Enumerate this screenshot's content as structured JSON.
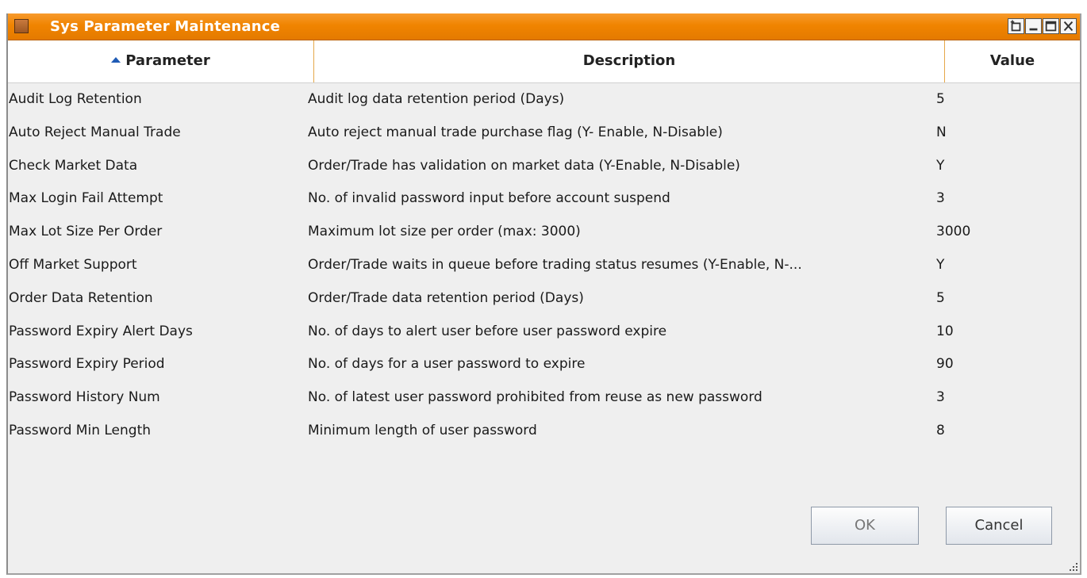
{
  "window": {
    "title": "Sys Parameter Maintenance",
    "controls": [
      "pin-icon",
      "minimize-icon",
      "maximize-icon",
      "close-icon"
    ]
  },
  "table": {
    "columns": [
      "Parameter",
      "Description",
      "Value"
    ],
    "sort": {
      "column": "Parameter",
      "direction": "ascending"
    },
    "rows": [
      {
        "parameter": "Audit Log Retention",
        "description": "Audit log data retention period (Days)",
        "value": "5"
      },
      {
        "parameter": "Auto Reject Manual Trade",
        "description": "Auto reject manual trade purchase flag (Y- Enable, N-Disable)",
        "value": "N"
      },
      {
        "parameter": "Check Market Data",
        "description": "Order/Trade has validation on market data (Y-Enable, N-Disable)",
        "value": "Y"
      },
      {
        "parameter": "Max Login Fail Attempt",
        "description": "No. of invalid password input before account suspend",
        "value": "3"
      },
      {
        "parameter": "Max Lot Size Per Order",
        "description": "Maximum lot size per order  (max: 3000)",
        "value": "3000"
      },
      {
        "parameter": "Off Market Support",
        "description": "Order/Trade waits in queue before trading status resumes (Y-Enable, N-...",
        "value": "Y"
      },
      {
        "parameter": "Order Data Retention",
        "description": "Order/Trade data retention period (Days)",
        "value": "5"
      },
      {
        "parameter": "Password Expiry Alert Days",
        "description": "No. of days to alert user before user password expire",
        "value": "10"
      },
      {
        "parameter": "Password Expiry Period",
        "description": "No. of days for a user password to expire",
        "value": "90"
      },
      {
        "parameter": "Password History Num",
        "description": "No. of latest user password prohibited from reuse as new password",
        "value": "3"
      },
      {
        "parameter": "Password Min Length",
        "description": "Minimum length of user password",
        "value": "8"
      }
    ]
  },
  "buttons": {
    "ok": "OK",
    "cancel": "Cancel"
  },
  "colors": {
    "titlebar": "#f08400",
    "header_separator": "#e5a84a",
    "sort_arrow": "#1f5bb5"
  }
}
